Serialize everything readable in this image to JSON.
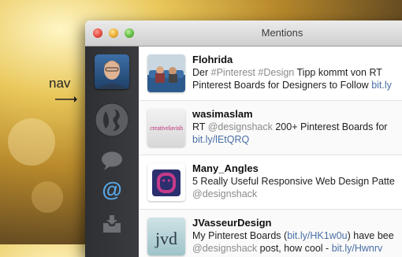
{
  "annotation": {
    "label": "nav"
  },
  "window": {
    "title": "Mentions"
  },
  "tweets": [
    {
      "username": "Flohrida",
      "line1_a": "Der ",
      "line1_tag1": "#Pinterest",
      "line1_b": " ",
      "line1_tag2": "#Design",
      "line1_c": " Tipp kommt von RT ",
      "line2_a": "Pinterest Boards for Designers to Follow ",
      "line2_link": "bit.ly"
    },
    {
      "username": "wasimaslam",
      "thumb_text": "creativelavish",
      "line1_a": "RT ",
      "line1_mention": "@designshack",
      "line1_b": " 200+ Pinterest Boards for",
      "line2_link": "bit.ly/lEtQRQ"
    },
    {
      "username": "Many_Angles",
      "line1_a": "5 Really Useful Responsive Web Design Patte",
      "line2_mention": "@designshack"
    },
    {
      "username": "JVasseurDesign",
      "thumb_text": "jvd",
      "line1_a": "My Pinterest Boards (",
      "line1_link": "bit.ly/HK1w0u",
      "line1_b": ") have bee",
      "line2_mention": "@designshack",
      "line2_b": " post, how cool - ",
      "line2_link": "bit.ly/Hwnrv"
    }
  ],
  "colors": {
    "link": "#4a6fa5",
    "muted": "#8a8a8a",
    "sidebar": "#2d2f33",
    "active_nav": "#5aa8e6"
  },
  "nav_icons": [
    "profile-avatar",
    "globe-shape-icon",
    "speech-bubble-icon",
    "at-sign-icon",
    "inbox-tray-icon"
  ]
}
